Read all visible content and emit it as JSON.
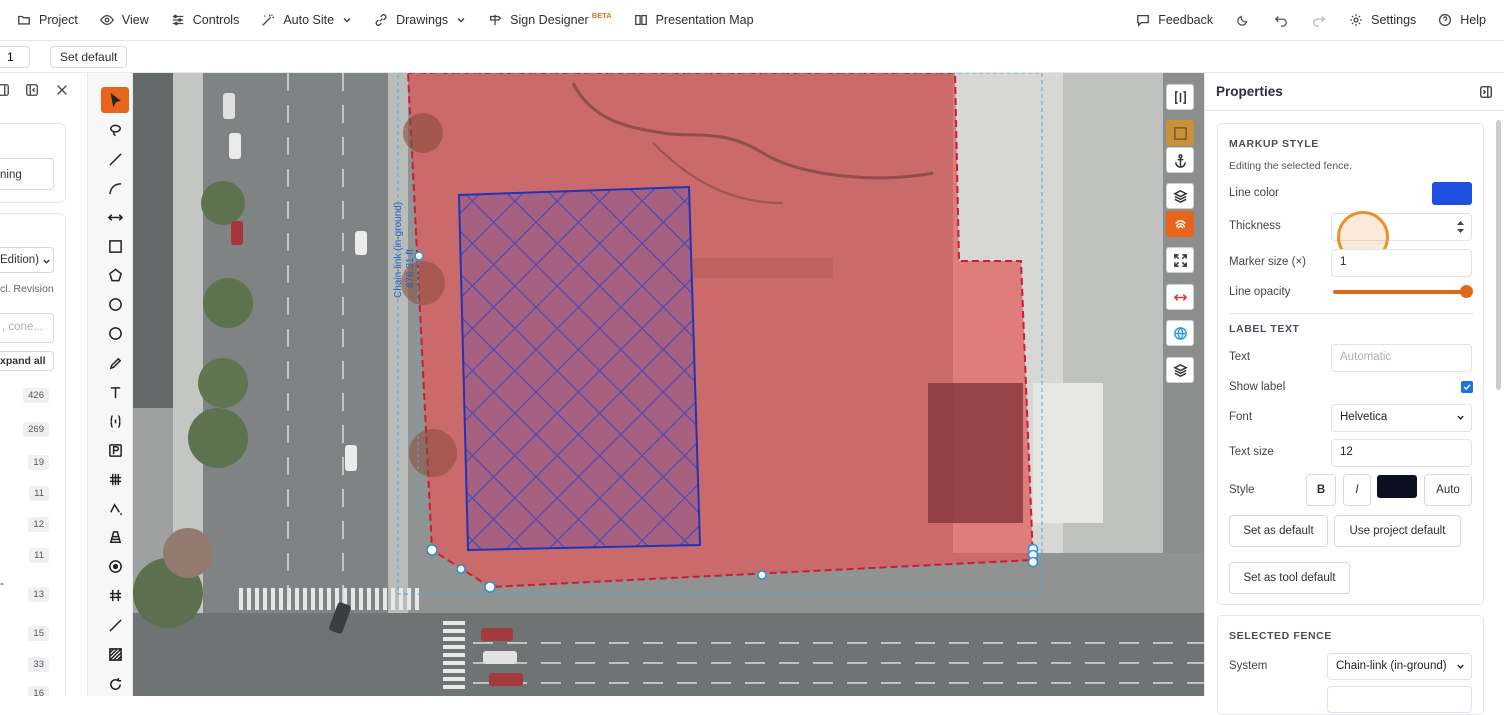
{
  "menubar": {
    "items": [
      {
        "label": "Project",
        "icon": "folder-icon"
      },
      {
        "label": "View",
        "icon": "eye-icon"
      },
      {
        "label": "Controls",
        "icon": "sliders-icon"
      },
      {
        "label": "Auto Site",
        "icon": "magic-wand-icon"
      },
      {
        "label": "Drawings",
        "icon": "link-icon"
      },
      {
        "label": "Sign Designer",
        "icon": "signpost-icon",
        "badge": "BETA"
      },
      {
        "label": "Presentation Map",
        "icon": "book-icon"
      }
    ],
    "right": {
      "feedback": "Feedback",
      "settings": "Settings",
      "help": "Help"
    }
  },
  "toolbar2": {
    "page_value": "1",
    "set_default": "Set default"
  },
  "left_panel": {
    "partial_labels": {
      "ning": "ning",
      "edition": "Edition)",
      "revision": "cl. Revision",
      "search_placeholder": ", cone...",
      "expand_all": "xpand all",
      "dash": "-"
    },
    "counts": [
      "426",
      "269",
      "19",
      "11",
      "12",
      "11",
      "13",
      "15",
      "33",
      "16"
    ]
  },
  "map": {
    "fence_label": "Chain-link (in-ground)",
    "fence_length": "876.31 ft",
    "colors": {
      "fence_fill": "#e05a5a",
      "fence_line": "#c0203a",
      "hatch": "#2a3fd1"
    }
  },
  "properties": {
    "title": "Properties",
    "markup_style": {
      "title": "MARKUP STYLE",
      "subtitle": "Editing the selected fence.",
      "line_color_label": "Line color",
      "line_color": "#1f4fe0",
      "thickness_label": "Thickness",
      "thickness_value": "",
      "marker_size_label": "Marker size (×)",
      "marker_size_value": "1",
      "line_opacity_label": "Line opacity",
      "line_opacity_value": 1.0
    },
    "label_text": {
      "title": "LABEL TEXT",
      "text_label": "Text",
      "text_placeholder": "Automatic",
      "show_label_label": "Show label",
      "show_label": true,
      "font_label": "Font",
      "font_value": "Helvetica",
      "text_size_label": "Text size",
      "text_size_value": "12",
      "style_label": "Style",
      "bold": "B",
      "italic": "I",
      "text_color": "#0b1020",
      "auto": "Auto",
      "set_as_default": "Set as default",
      "use_project_default": "Use project default",
      "set_as_tool_default": "Set as tool default"
    },
    "selected_fence": {
      "title": "SELECTED FENCE",
      "system_label": "System",
      "system_value": "Chain-link (in-ground)"
    }
  }
}
